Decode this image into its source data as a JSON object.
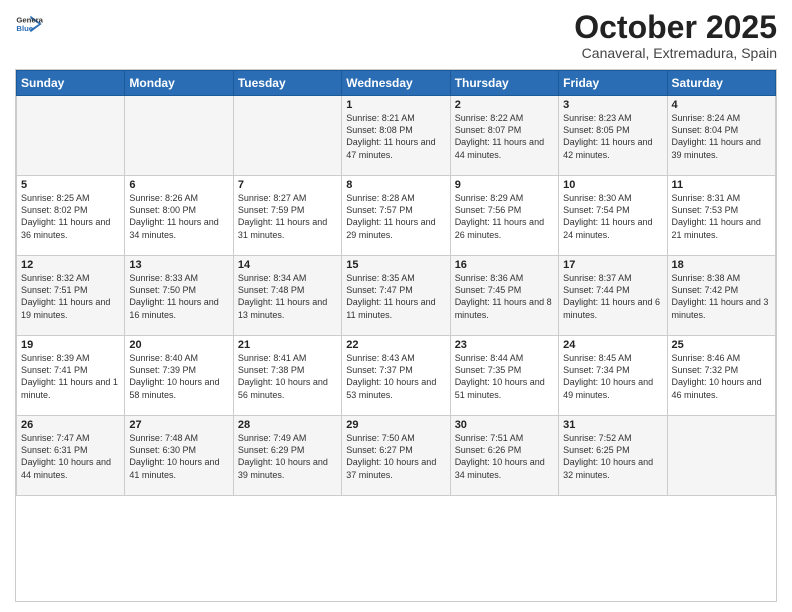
{
  "logo": {
    "general": "General",
    "blue": "Blue"
  },
  "title": "October 2025",
  "subtitle": "Canaveral, Extremadura, Spain",
  "weekdays": [
    "Sunday",
    "Monday",
    "Tuesday",
    "Wednesday",
    "Thursday",
    "Friday",
    "Saturday"
  ],
  "weeks": [
    [
      {
        "day": "",
        "sunrise": "",
        "sunset": "",
        "daylight": ""
      },
      {
        "day": "",
        "sunrise": "",
        "sunset": "",
        "daylight": ""
      },
      {
        "day": "",
        "sunrise": "",
        "sunset": "",
        "daylight": ""
      },
      {
        "day": "1",
        "sunrise": "Sunrise: 8:21 AM",
        "sunset": "Sunset: 8:08 PM",
        "daylight": "Daylight: 11 hours and 47 minutes."
      },
      {
        "day": "2",
        "sunrise": "Sunrise: 8:22 AM",
        "sunset": "Sunset: 8:07 PM",
        "daylight": "Daylight: 11 hours and 44 minutes."
      },
      {
        "day": "3",
        "sunrise": "Sunrise: 8:23 AM",
        "sunset": "Sunset: 8:05 PM",
        "daylight": "Daylight: 11 hours and 42 minutes."
      },
      {
        "day": "4",
        "sunrise": "Sunrise: 8:24 AM",
        "sunset": "Sunset: 8:04 PM",
        "daylight": "Daylight: 11 hours and 39 minutes."
      }
    ],
    [
      {
        "day": "5",
        "sunrise": "Sunrise: 8:25 AM",
        "sunset": "Sunset: 8:02 PM",
        "daylight": "Daylight: 11 hours and 36 minutes."
      },
      {
        "day": "6",
        "sunrise": "Sunrise: 8:26 AM",
        "sunset": "Sunset: 8:00 PM",
        "daylight": "Daylight: 11 hours and 34 minutes."
      },
      {
        "day": "7",
        "sunrise": "Sunrise: 8:27 AM",
        "sunset": "Sunset: 7:59 PM",
        "daylight": "Daylight: 11 hours and 31 minutes."
      },
      {
        "day": "8",
        "sunrise": "Sunrise: 8:28 AM",
        "sunset": "Sunset: 7:57 PM",
        "daylight": "Daylight: 11 hours and 29 minutes."
      },
      {
        "day": "9",
        "sunrise": "Sunrise: 8:29 AM",
        "sunset": "Sunset: 7:56 PM",
        "daylight": "Daylight: 11 hours and 26 minutes."
      },
      {
        "day": "10",
        "sunrise": "Sunrise: 8:30 AM",
        "sunset": "Sunset: 7:54 PM",
        "daylight": "Daylight: 11 hours and 24 minutes."
      },
      {
        "day": "11",
        "sunrise": "Sunrise: 8:31 AM",
        "sunset": "Sunset: 7:53 PM",
        "daylight": "Daylight: 11 hours and 21 minutes."
      }
    ],
    [
      {
        "day": "12",
        "sunrise": "Sunrise: 8:32 AM",
        "sunset": "Sunset: 7:51 PM",
        "daylight": "Daylight: 11 hours and 19 minutes."
      },
      {
        "day": "13",
        "sunrise": "Sunrise: 8:33 AM",
        "sunset": "Sunset: 7:50 PM",
        "daylight": "Daylight: 11 hours and 16 minutes."
      },
      {
        "day": "14",
        "sunrise": "Sunrise: 8:34 AM",
        "sunset": "Sunset: 7:48 PM",
        "daylight": "Daylight: 11 hours and 13 minutes."
      },
      {
        "day": "15",
        "sunrise": "Sunrise: 8:35 AM",
        "sunset": "Sunset: 7:47 PM",
        "daylight": "Daylight: 11 hours and 11 minutes."
      },
      {
        "day": "16",
        "sunrise": "Sunrise: 8:36 AM",
        "sunset": "Sunset: 7:45 PM",
        "daylight": "Daylight: 11 hours and 8 minutes."
      },
      {
        "day": "17",
        "sunrise": "Sunrise: 8:37 AM",
        "sunset": "Sunset: 7:44 PM",
        "daylight": "Daylight: 11 hours and 6 minutes."
      },
      {
        "day": "18",
        "sunrise": "Sunrise: 8:38 AM",
        "sunset": "Sunset: 7:42 PM",
        "daylight": "Daylight: 11 hours and 3 minutes."
      }
    ],
    [
      {
        "day": "19",
        "sunrise": "Sunrise: 8:39 AM",
        "sunset": "Sunset: 7:41 PM",
        "daylight": "Daylight: 11 hours and 1 minute."
      },
      {
        "day": "20",
        "sunrise": "Sunrise: 8:40 AM",
        "sunset": "Sunset: 7:39 PM",
        "daylight": "Daylight: 10 hours and 58 minutes."
      },
      {
        "day": "21",
        "sunrise": "Sunrise: 8:41 AM",
        "sunset": "Sunset: 7:38 PM",
        "daylight": "Daylight: 10 hours and 56 minutes."
      },
      {
        "day": "22",
        "sunrise": "Sunrise: 8:43 AM",
        "sunset": "Sunset: 7:37 PM",
        "daylight": "Daylight: 10 hours and 53 minutes."
      },
      {
        "day": "23",
        "sunrise": "Sunrise: 8:44 AM",
        "sunset": "Sunset: 7:35 PM",
        "daylight": "Daylight: 10 hours and 51 minutes."
      },
      {
        "day": "24",
        "sunrise": "Sunrise: 8:45 AM",
        "sunset": "Sunset: 7:34 PM",
        "daylight": "Daylight: 10 hours and 49 minutes."
      },
      {
        "day": "25",
        "sunrise": "Sunrise: 8:46 AM",
        "sunset": "Sunset: 7:32 PM",
        "daylight": "Daylight: 10 hours and 46 minutes."
      }
    ],
    [
      {
        "day": "26",
        "sunrise": "Sunrise: 7:47 AM",
        "sunset": "Sunset: 6:31 PM",
        "daylight": "Daylight: 10 hours and 44 minutes."
      },
      {
        "day": "27",
        "sunrise": "Sunrise: 7:48 AM",
        "sunset": "Sunset: 6:30 PM",
        "daylight": "Daylight: 10 hours and 41 minutes."
      },
      {
        "day": "28",
        "sunrise": "Sunrise: 7:49 AM",
        "sunset": "Sunset: 6:29 PM",
        "daylight": "Daylight: 10 hours and 39 minutes."
      },
      {
        "day": "29",
        "sunrise": "Sunrise: 7:50 AM",
        "sunset": "Sunset: 6:27 PM",
        "daylight": "Daylight: 10 hours and 37 minutes."
      },
      {
        "day": "30",
        "sunrise": "Sunrise: 7:51 AM",
        "sunset": "Sunset: 6:26 PM",
        "daylight": "Daylight: 10 hours and 34 minutes."
      },
      {
        "day": "31",
        "sunrise": "Sunrise: 7:52 AM",
        "sunset": "Sunset: 6:25 PM",
        "daylight": "Daylight: 10 hours and 32 minutes."
      },
      {
        "day": "",
        "sunrise": "",
        "sunset": "",
        "daylight": ""
      }
    ]
  ]
}
